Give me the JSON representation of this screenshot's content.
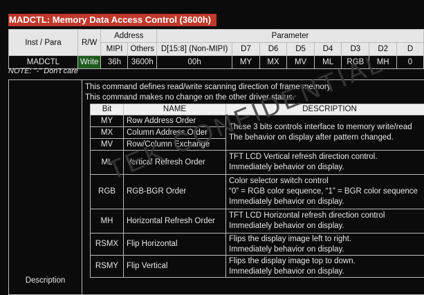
{
  "title": "MADCTL: Memory Data Access Control (3600h)",
  "param_table": {
    "h_inst": "Inst / Para",
    "h_rw": "R/W",
    "h_address": "Address",
    "h_parameter": "Parameter",
    "h_mipi": "MIPI",
    "h_others": "Others",
    "h_d15": "D[15:8] (Non-MIPI)",
    "bits": [
      "D7",
      "D6",
      "D5",
      "D4",
      "D3",
      "D2",
      "D"
    ],
    "row_inst": "MADCTL",
    "row_rw": "Write",
    "row_mipi": "36h",
    "row_others": "3600h",
    "row_d15": "00h",
    "row_bits": [
      "MY",
      "MX",
      "MV",
      "ML",
      "RGB",
      "MH",
      "0"
    ]
  },
  "note": "NOTE: \"-\" Don't care",
  "description": {
    "label": "Description",
    "line1": "This command defines read/write scanning direction of frame memory.",
    "line2": "This command makes no change on the other driver status.",
    "headers": {
      "bit": "Bit",
      "name": "NAME",
      "desc": "DESCRIPTION"
    },
    "rows": [
      {
        "bit": "MY",
        "name": "Row Address Order"
      },
      {
        "bit": "MX",
        "name": "Column Address Order"
      },
      {
        "bit": "MV",
        "name": "Row/Column Exchange"
      },
      {
        "bit": "ML",
        "name": "Vertical Refresh Order",
        "desc1": "TFT LCD Vertical refresh direction control.",
        "desc2": "Immediately behavior on display."
      },
      {
        "bit": "RGB",
        "name": "RGB-BGR Order",
        "desc1": "Color selector switch control",
        "desc2": "“0” = RGB color sequence, “1” = BGR color sequence",
        "desc3": "Immediately behavior on display."
      },
      {
        "bit": "MH",
        "name": "Horizontal Refresh Order",
        "desc1": "TFT LCD Horizontal refresh direction control",
        "desc2": "Immediately behavior on display."
      },
      {
        "bit": "RSMX",
        "name": "Flip Horizontal",
        "desc1": "Flips the display image left to right.",
        "desc2": "Immediately behavior on display."
      },
      {
        "bit": "RSMY",
        "name": "Flip Vertical",
        "desc1": "Flips the display image top to down.",
        "desc2": "Immediately behavior on display."
      }
    ],
    "group_desc1": "These 3 bits controls interface to memory write/read",
    "group_desc2": "The behavior on display after pattern changed."
  },
  "watermark": "TEK CONFIDENTIAL"
}
